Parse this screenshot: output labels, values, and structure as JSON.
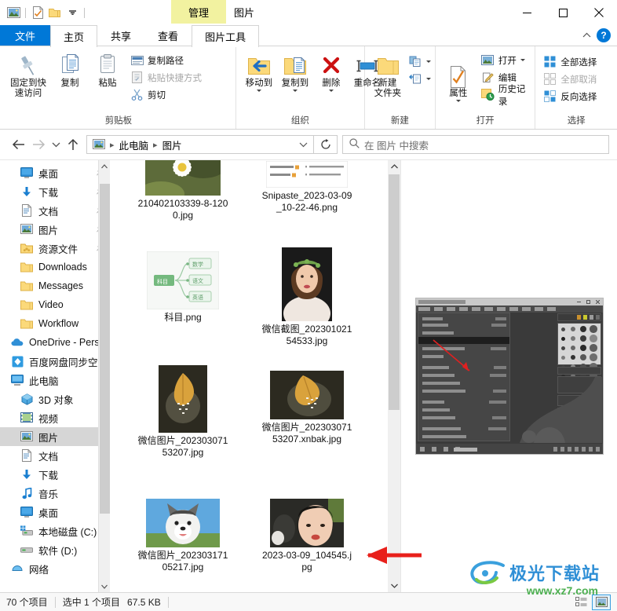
{
  "window": {
    "context_tab_group": "管理",
    "title": "图片",
    "minimize": "minimize",
    "maximize": "maximize",
    "close": "close"
  },
  "quick_access": [
    {
      "name": "pictures-icon",
      "label": "图片"
    },
    {
      "name": "properties-icon",
      "label": "属性"
    },
    {
      "name": "new-folder-icon",
      "label": "新建文件夹"
    },
    {
      "name": "customize-dropdown",
      "label": "自定义快速访问工具栏"
    }
  ],
  "tabs": [
    {
      "label": "文件",
      "id": "file",
      "active": false
    },
    {
      "label": "主页",
      "id": "home",
      "active": true
    },
    {
      "label": "共享",
      "id": "share",
      "active": false
    },
    {
      "label": "查看",
      "id": "view",
      "active": false
    },
    {
      "label": "图片工具",
      "id": "picture-tools",
      "active": false
    }
  ],
  "tab_right": {
    "collapse_label": "折叠功能区",
    "help_label": "?"
  },
  "ribbon": {
    "groups": [
      {
        "title": "剪贴板",
        "big_buttons": [
          {
            "label": "固定到快\n速访问",
            "icon": "pin-icon",
            "label_line1": "固定到快",
            "label_line2": "速访问"
          },
          {
            "label": "复制",
            "icon": "copy-icon"
          },
          {
            "label": "粘贴",
            "icon": "paste-icon"
          }
        ],
        "small_buttons": [
          {
            "label": "复制路径",
            "icon": "copy-path-icon",
            "disabled": false
          },
          {
            "label": "粘贴快捷方式",
            "icon": "paste-shortcut-icon",
            "disabled": true
          },
          {
            "label": "剪切",
            "icon": "cut-icon",
            "disabled": false
          }
        ]
      },
      {
        "title": "组织",
        "big_buttons": [
          {
            "label": "移动到",
            "icon": "move-to-icon",
            "has_caret": true
          },
          {
            "label": "复制到",
            "icon": "copy-to-icon",
            "has_caret": true
          },
          {
            "label": "删除",
            "icon": "delete-icon",
            "has_caret": true
          },
          {
            "label": "重命名",
            "icon": "rename-icon"
          }
        ]
      },
      {
        "title": "新建",
        "big_buttons": [
          {
            "label_line1": "新建",
            "label_line2": "文件夹",
            "icon": "new-folder-icon"
          }
        ],
        "small_buttons": [
          {
            "label": "",
            "icon": "new-item-icon",
            "has_caret": true
          },
          {
            "label": "",
            "icon": "easy-access-icon",
            "has_caret": true
          }
        ]
      },
      {
        "title": "打开",
        "big_buttons": [
          {
            "label": "属性",
            "icon": "properties-icon",
            "has_caret": true
          }
        ],
        "small_buttons": [
          {
            "label": "打开",
            "icon": "open-icon",
            "has_caret": true
          },
          {
            "label": "编辑",
            "icon": "edit-icon"
          },
          {
            "label": "历史记录",
            "icon": "history-icon"
          }
        ]
      },
      {
        "title": "选择",
        "small_buttons": [
          {
            "label": "全部选择",
            "icon": "select-all-icon"
          },
          {
            "label": "全部取消",
            "icon": "select-none-icon",
            "disabled": true
          },
          {
            "label": "反向选择",
            "icon": "invert-selection-icon"
          }
        ]
      }
    ]
  },
  "addressbar": {
    "back": "后退",
    "forward": "前进",
    "recent": "最近浏览的位置",
    "up": "上移到 此电脑",
    "breadcrumbs": [
      "此电脑",
      "图片"
    ],
    "path_icon": "pictures-icon",
    "dropdown": "历史记录",
    "refresh": "刷新",
    "search_placeholder": "在 图片 中搜索"
  },
  "navpane": {
    "items": [
      {
        "label": "桌面",
        "icon": "desktop-icon",
        "level": 1,
        "pinned": true
      },
      {
        "label": "下载",
        "icon": "downloads-icon",
        "level": 1,
        "pinned": true
      },
      {
        "label": "文档",
        "icon": "documents-icon",
        "level": 1,
        "pinned": true
      },
      {
        "label": "图片",
        "icon": "pictures-icon",
        "level": 1,
        "pinned": true
      },
      {
        "label": "资源文件",
        "icon": "resource-folder-icon",
        "level": 1,
        "pinned": true
      },
      {
        "label": "Downloads",
        "icon": "folder-icon",
        "level": 1,
        "pinned": false
      },
      {
        "label": "Messages",
        "icon": "folder-icon",
        "level": 1,
        "pinned": false
      },
      {
        "label": "Video",
        "icon": "folder-icon",
        "level": 1,
        "pinned": false
      },
      {
        "label": "Workflow",
        "icon": "folder-icon",
        "level": 1,
        "pinned": false
      },
      {
        "label": "OneDrive - Perso",
        "icon": "onedrive-icon",
        "level": 0,
        "pinned": false
      },
      {
        "label": "百度网盘同步空间",
        "icon": "baidu-netdisk-icon",
        "level": 0,
        "pinned": false
      },
      {
        "label": "此电脑",
        "icon": "this-pc-icon",
        "level": 0,
        "pinned": false
      },
      {
        "label": "3D 对象",
        "icon": "3d-objects-icon",
        "level": 1,
        "pinned": false
      },
      {
        "label": "视频",
        "icon": "videos-icon",
        "level": 1,
        "pinned": false
      },
      {
        "label": "图片",
        "icon": "pictures-icon",
        "level": 1,
        "pinned": false,
        "selected": true
      },
      {
        "label": "文档",
        "icon": "documents-icon",
        "level": 1,
        "pinned": false
      },
      {
        "label": "下载",
        "icon": "downloads-icon",
        "level": 1,
        "pinned": false
      },
      {
        "label": "音乐",
        "icon": "music-icon",
        "level": 1,
        "pinned": false
      },
      {
        "label": "桌面",
        "icon": "desktop-icon",
        "level": 1,
        "pinned": false
      },
      {
        "label": "本地磁盘 (C:)",
        "icon": "local-disk-icon",
        "level": 1,
        "pinned": false
      },
      {
        "label": "软件 (D:)",
        "icon": "drive-icon",
        "level": 1,
        "pinned": false
      },
      {
        "label": "网络",
        "icon": "network-icon",
        "level": 0,
        "pinned": false
      }
    ]
  },
  "files": [
    {
      "name": "210402103339-8-1200.jpg",
      "type": "image",
      "thumb": "daisy",
      "col": 0,
      "row": 0
    },
    {
      "name": "Snipaste_2023-03-09_10-22-46.png",
      "type": "image",
      "thumb": "document-screenshot",
      "col": 1,
      "row": 0
    },
    {
      "name": "科目.png",
      "type": "image",
      "thumb": "mindmap",
      "col": 0,
      "row": 1
    },
    {
      "name": "微信截图_20230102154533.jpg",
      "type": "image",
      "thumb": "bride-portrait",
      "col": 1,
      "row": 1
    },
    {
      "name": "微信图片_20230307153207.jpg",
      "type": "image",
      "thumb": "leaf-portrait",
      "col": 0,
      "row": 2
    },
    {
      "name": "微信图片_20230307153207.xnbak.jpg",
      "type": "image",
      "thumb": "leaf-landscape",
      "col": 1,
      "row": 2
    },
    {
      "name": "微信图片_20230317105217.jpg",
      "type": "image",
      "thumb": "husky-puppy",
      "col": 0,
      "row": 3
    },
    {
      "name": "2023-03-09_104545.jpg",
      "type": "image",
      "thumb": "woman-portrait",
      "col": 1,
      "row": 3,
      "selected": true
    }
  ],
  "preview": {
    "label": "预览窗格",
    "content_description": "Photoshop 菜单截图"
  },
  "statusbar": {
    "item_count": "70 个项目",
    "selection": "选中 1 个项目",
    "size": "67.5 KB",
    "views": [
      {
        "name": "details-view",
        "label": "详细信息",
        "active": false
      },
      {
        "name": "large-icons-view",
        "label": "大图标",
        "active": true
      }
    ]
  },
  "watermark": {
    "brand": "极光下载站",
    "url": "www.xz7.com"
  },
  "annotation": {
    "type": "red-arrow",
    "points_to": "2023-03-09_104545.jpg"
  },
  "colors": {
    "accent": "#0078d7",
    "context_tab": "#f2f2a0",
    "selection": "#cce8ff",
    "arrow": "#e02020",
    "watermark_brand": "#2f8fd6",
    "watermark_url": "#4caf50"
  }
}
